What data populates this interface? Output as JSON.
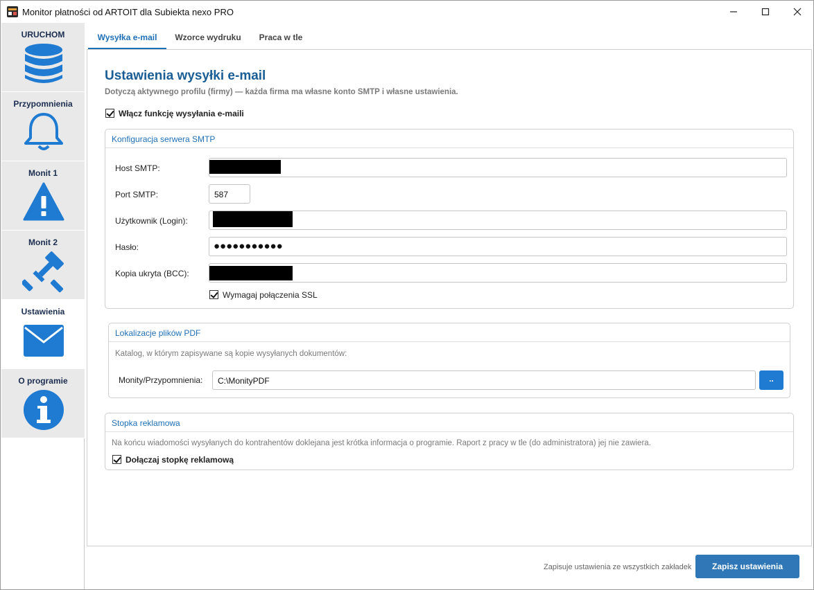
{
  "window": {
    "title": "Monitor płatności od ARTOIT dla Subiekta nexo PRO",
    "controls": [
      "minimize-icon",
      "maximize-icon",
      "close-icon"
    ]
  },
  "sidebar": {
    "items": [
      {
        "label": "URUCHOM",
        "icon": "database-icon",
        "active": false
      },
      {
        "label": "Przypomnienia",
        "icon": "bell-icon",
        "active": false
      },
      {
        "label": "Monit 1",
        "icon": "warning-icon",
        "active": false
      },
      {
        "label": "Monit 2",
        "icon": "gavel-icon",
        "active": false
      },
      {
        "label": "Ustawienia",
        "icon": "envelope-icon",
        "active": true
      },
      {
        "label": "O programie",
        "icon": "info-icon",
        "active": false
      }
    ],
    "icon_color": "#1f7ad1"
  },
  "tabs": [
    {
      "label": "Wysyłka e-mail",
      "active": true
    },
    {
      "label": "Wzorce wydruku",
      "active": false
    },
    {
      "label": "Praca w tle",
      "active": false
    }
  ],
  "main": {
    "heading": "Ustawienia wysyłki e-mail",
    "subtitle": "Dotyczą aktywnego profilu (firmy) — każda firma ma własne konto SMTP i własne ustawienia.",
    "enable_checkbox": {
      "label": "Włącz funkcję wysyłania e-maili",
      "checked": true
    }
  },
  "smtp": {
    "title": "Konfiguracja serwera SMTP",
    "host_label": "Host SMTP:",
    "host_value": "",
    "port_label": "Port SMTP:",
    "port_value": "587",
    "user_label": "Użytkownik (Login):",
    "user_value": "",
    "password_label": "Hasło:",
    "password_value": "●●●●●●●●●●●",
    "bcc_label": "Kopia ukryta (BCC):",
    "bcc_value": "",
    "ssl_checkbox": {
      "label": "Wymagaj połączenia SSL",
      "checked": true
    }
  },
  "pdf": {
    "title": "Lokalizacje plików PDF",
    "description": "Katalog, w którym zapisywane są kopie wysyłanych dokumentów:",
    "path_label": "Monity/Przypomnienia:",
    "path_value": "C:\\MonityPDF",
    "browse_label": ".."
  },
  "footer_ad": {
    "title": "Stopka reklamowa",
    "description": "Na końcu wiadomości wysyłanych do kontrahentów doklejana jest krótka informacja o programie. Raport z pracy w tle (do administratora) jej nie zawiera.",
    "checkbox": {
      "label": "Dołączaj stopkę reklamową",
      "checked": true
    }
  },
  "bottom": {
    "note": "Zapisuje ustawienia ze wszystkich zakładek",
    "save_label": "Zapisz ustawienia"
  }
}
